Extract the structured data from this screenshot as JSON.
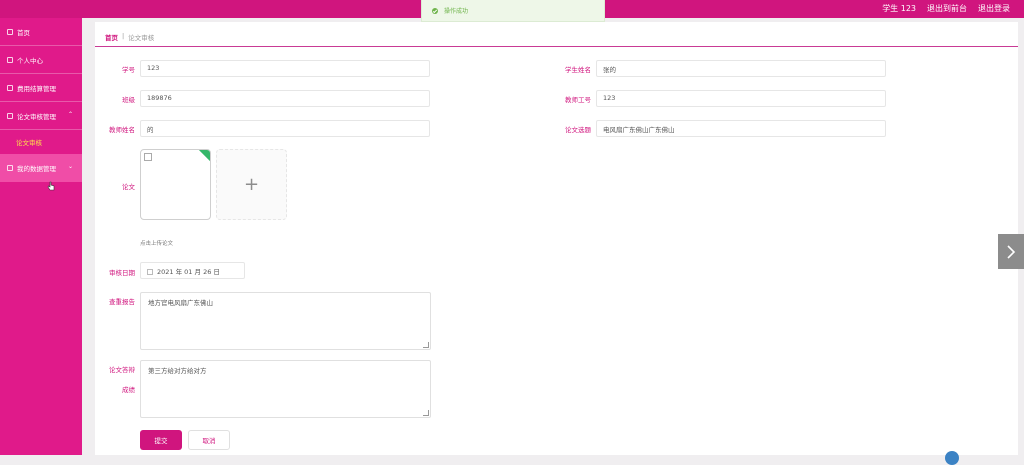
{
  "topbar": {
    "user": "学生 123",
    "back_to_front": "退出到前台",
    "logout": "退出登录"
  },
  "toast": {
    "message": "操作成功"
  },
  "sidebar": {
    "items": [
      {
        "label": "首页",
        "icon": "home-icon"
      },
      {
        "label": "个人中心",
        "icon": "user-icon"
      },
      {
        "label": "费用结算管理",
        "icon": "file-icon"
      },
      {
        "label": "论文审核管理",
        "icon": "file-icon"
      },
      {
        "label": "论文审核",
        "sub": true
      },
      {
        "label": "我的数据管理",
        "icon": "folder-icon"
      }
    ]
  },
  "breadcrumb": {
    "home": "首页",
    "separator": "|",
    "current": "论文审核"
  },
  "form": {
    "student_no_label": "学号",
    "student_no": "123",
    "student_name_label": "学生姓名",
    "student_name": "张的",
    "class_label": "班级",
    "class_value": "189876",
    "teacher_no_label": "教师工号",
    "teacher_no": "123",
    "teacher_name_label": "教师姓名",
    "teacher_name": "的",
    "thesis_topic_label": "论文选题",
    "thesis_topic": "电风扇广东佛山广东佛山",
    "thesis_label": "论文",
    "thesis_hint": "点击上传论文",
    "review_date_label": "审核日期",
    "review_date": "2021 年 01 月 26 日",
    "plagiarism_label": "查重报告",
    "plagiarism": "地方官电风扇广东佛山",
    "defense_label_1": "论文答辩",
    "defense_label_2": "成绩",
    "defense": "第三方给对方给对方",
    "submit": "提交",
    "cancel": "取消"
  },
  "colors": {
    "brand": "#d0157e",
    "sidebar": "#e01a8a",
    "success": "#35b76a"
  }
}
